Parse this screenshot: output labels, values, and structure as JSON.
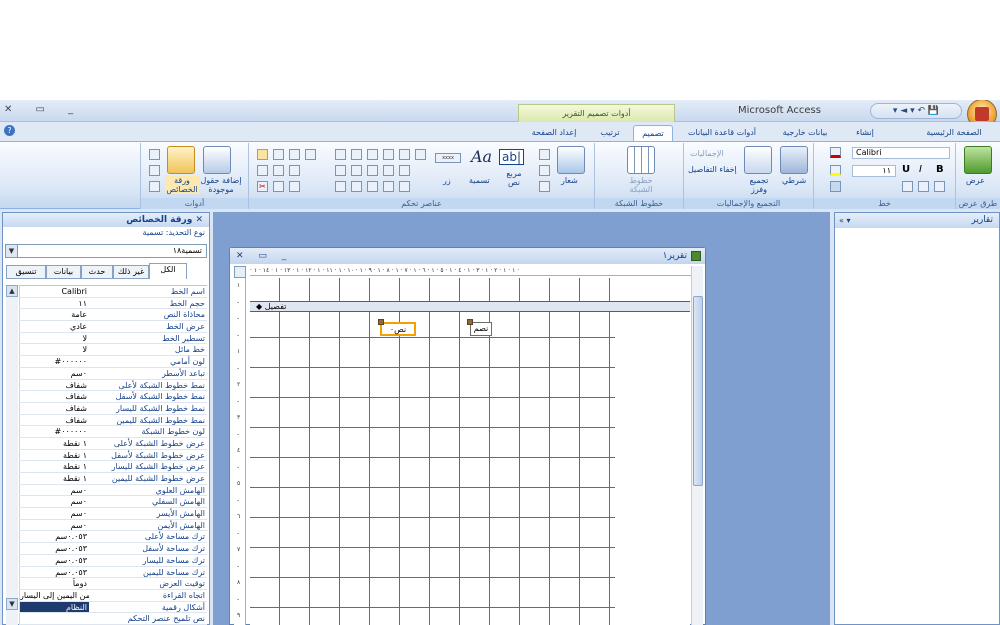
{
  "window": {
    "app_title": "Microsoft Access",
    "context_tab_label": "أدوات تصميم التقرير",
    "controls": "✕ ▭ _",
    "qat_label": "▾ ◄ ▾ ↶ 💾"
  },
  "ribbon_tabs": [
    "الصفحة الرئيسية",
    "إنشاء",
    "بيانات خارجية",
    "أدوات قاعدة البيانات",
    "تصميم",
    "ترتيب",
    "إعداد الصفحة"
  ],
  "ribbon": {
    "groups": {
      "views": "طرق عرض",
      "font": "خط",
      "grouping": "التجميع والإجماليات",
      "gridlines": "خطوط الشبكة",
      "controls": "عناصر تحكم",
      "tools": "أدوات"
    },
    "view_button": "عرض",
    "font_name": "Calibri",
    "font_size": "١١",
    "conditional": "شرطي",
    "group_sort": "تجميع وفرز",
    "totals": "الإجماليات",
    "hide_details": "إخفاء التفاصيل",
    "gridlines_label": "خطوط الشبكة",
    "logo_label": "شعار",
    "textbox_label": "مربع نص",
    "title_label": "تسمية",
    "button_label": "زر",
    "aa_label": "Aa",
    "ab_label": "ab|",
    "add_fields": "إضافة حقول موجودة",
    "property_sheet": "ورقة الخصائص",
    "bold": "B",
    "italic": "I",
    "underline": "U"
  },
  "property_sheet": {
    "title": "ورقة الخصائص",
    "selection_type": "نوع التحديد: تسمية",
    "selected_object": "تسمية١٨",
    "tabs": [
      "الكل",
      "غير ذلك",
      "حدث",
      "بيانات",
      "تنسيق"
    ],
    "rows": [
      {
        "name": "اسم الخط",
        "value": "Calibri"
      },
      {
        "name": "حجم الخط",
        "value": "١١"
      },
      {
        "name": "محاذاة النص",
        "value": "عامة"
      },
      {
        "name": "عرض الخط",
        "value": "عادي"
      },
      {
        "name": "تسطير الخط",
        "value": "لا"
      },
      {
        "name": "خط مائل",
        "value": "لا"
      },
      {
        "name": "لون أمامي",
        "value": "#٠٠٠٠٠٠"
      },
      {
        "name": "تباعد الأسطر",
        "value": "٠سم"
      },
      {
        "name": "نمط خطوط الشبكة لأعلى",
        "value": "شفاف"
      },
      {
        "name": "نمط خطوط الشبكة لأسفل",
        "value": "شفاف"
      },
      {
        "name": "نمط خطوط الشبكة لليسار",
        "value": "شفاف"
      },
      {
        "name": "نمط خطوط الشبكة لليمين",
        "value": "شفاف"
      },
      {
        "name": "لون خطوط الشبكة",
        "value": "#٠٠٠٠٠٠"
      },
      {
        "name": "عرض خطوط الشبكة لأعلى",
        "value": "١ نقطة"
      },
      {
        "name": "عرض خطوط الشبكة لأسفل",
        "value": "١ نقطة"
      },
      {
        "name": "عرض خطوط الشبكة لليسار",
        "value": "١ نقطة"
      },
      {
        "name": "عرض خطوط الشبكة لليمين",
        "value": "١ نقطة"
      },
      {
        "name": "الهامش العلوي",
        "value": "٠سم"
      },
      {
        "name": "الهامش السفلي",
        "value": "٠سم"
      },
      {
        "name": "الهامش الأيسر",
        "value": "٠سم"
      },
      {
        "name": "الهامش الأيمن",
        "value": "٠سم"
      },
      {
        "name": "ترك مساحة لأعلى",
        "value": "٠.٠٥٣سم"
      },
      {
        "name": "ترك مساحة لأسفل",
        "value": "٠.٠٥٣سم"
      },
      {
        "name": "ترك مساحة لليسار",
        "value": "٠.٠٥٣سم"
      },
      {
        "name": "ترك مساحة لليمين",
        "value": "٠.٠٥٣سم"
      },
      {
        "name": "توقيت العرض",
        "value": "دوماً"
      },
      {
        "name": "اتجاه القراءة",
        "value": "من اليمين إلى اليسار"
      },
      {
        "name": "أشكال رقمية",
        "value": "النظام"
      },
      {
        "name": "نص تلميح عنصر التحكم",
        "value": ""
      }
    ]
  },
  "report": {
    "title": "تقرير١",
    "controls": "✕ ▭ _",
    "ruler_text": "· ١ · ١ · ٢ · ١ · ٣ · ١ · ٤ · ١ · ٥ · ١ · ٦ · ١ · ٧ · ١ · ٨ · ١ · ٩ · ١ · ١٠ · ١ · ١١ · ١ · ١٢ · ١ · ١٣ · ١ · ١٤ · ١ ·",
    "vruler": [
      "١",
      "-",
      "-",
      "-",
      "١",
      "-",
      "٢",
      "-",
      "٣",
      "-",
      "٤",
      "-",
      "٥",
      "-",
      "٦",
      "-",
      "٧",
      "-",
      "٨",
      "-",
      "٩"
    ],
    "section": "تفصيل",
    "control_textbox": "نص٠",
    "control_label": "نصم"
  },
  "nav_pane": {
    "title": "تقارير",
    "collapse": "«"
  },
  "colors": {
    "accent": "#15428b",
    "ribbon_bg": "#dbe7f6",
    "workspace": "#7e9fcf",
    "selection": "#f4a000"
  }
}
